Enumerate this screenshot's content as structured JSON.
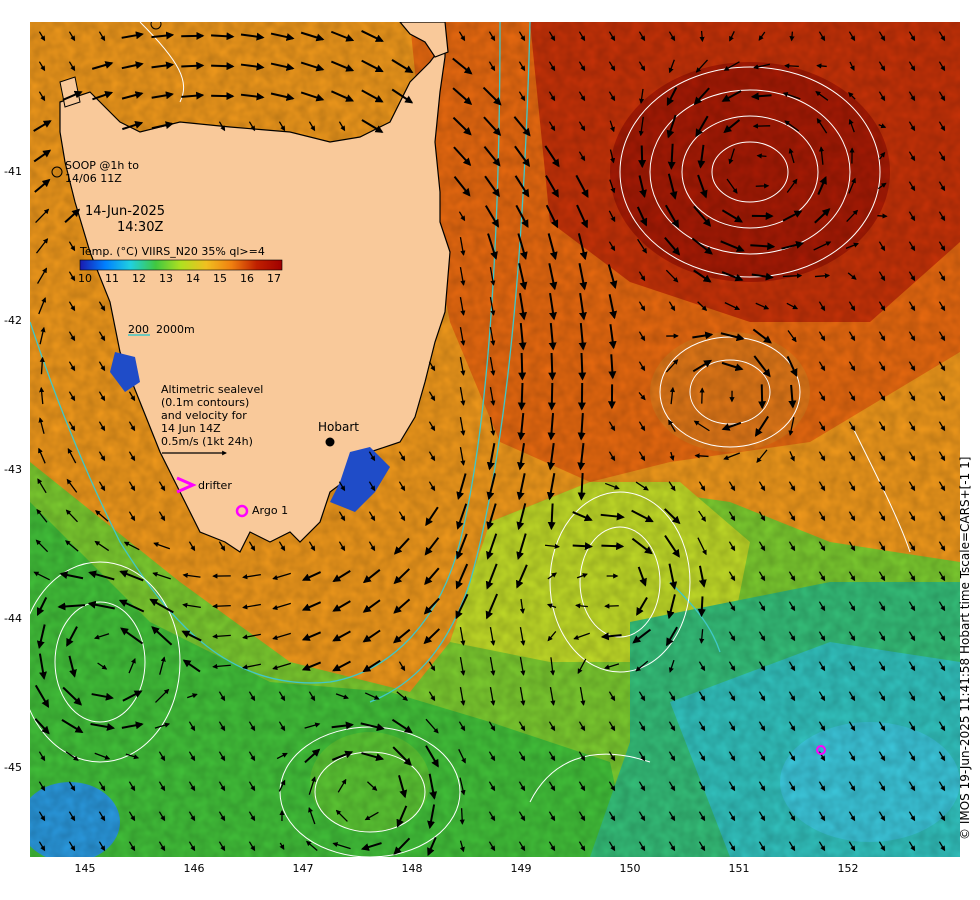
{
  "map": {
    "date": "14-Jun-2025",
    "time": "14:30Z",
    "soop_label": "SOOP @1h to\n14/06 11Z",
    "colorbar_title": "Temp. (°C) VIIRS_N20 35% ql>=4",
    "colorbar_ticks": [
      "10",
      "11",
      "12",
      "13",
      "14",
      "15",
      "16",
      "17"
    ],
    "colorbar_colors": [
      "#1a1ab0",
      "#0080ff",
      "#20d0e0",
      "#40c840",
      "#b0e020",
      "#f0c020",
      "#f08010",
      "#c02000",
      "#a00000"
    ],
    "isobath_label": "200  2000m",
    "altimetry_note": "Altimetric sealevel\n(0.1m contours)\nand velocity for\n14 Jun 14Z\n0.5m/s (1kt 24h)",
    "drifter_label": "drifter",
    "argo_label": "Argo 1",
    "city_label": "Hobart",
    "lat_ticks": [
      "-41",
      "-42",
      "-43",
      "-44",
      "-45"
    ],
    "lon_ticks": [
      "145",
      "146",
      "147",
      "148",
      "149",
      "150",
      "151",
      "152"
    ],
    "credit": "© IMOS 19-Jun-2025 11:41:58 Hobart time Tscale=CARS+[-1 1]",
    "colors": {
      "land": "#f9c99a",
      "coast": "#000000",
      "isobath": "#40c8c8",
      "contour": "#ffffff",
      "arrow": "#000000",
      "marker": "#ff00ff"
    },
    "region": {
      "lon_min": 144.5,
      "lon_max": 153.0,
      "lat_max": -40.35,
      "lat_min": -45.95
    }
  }
}
